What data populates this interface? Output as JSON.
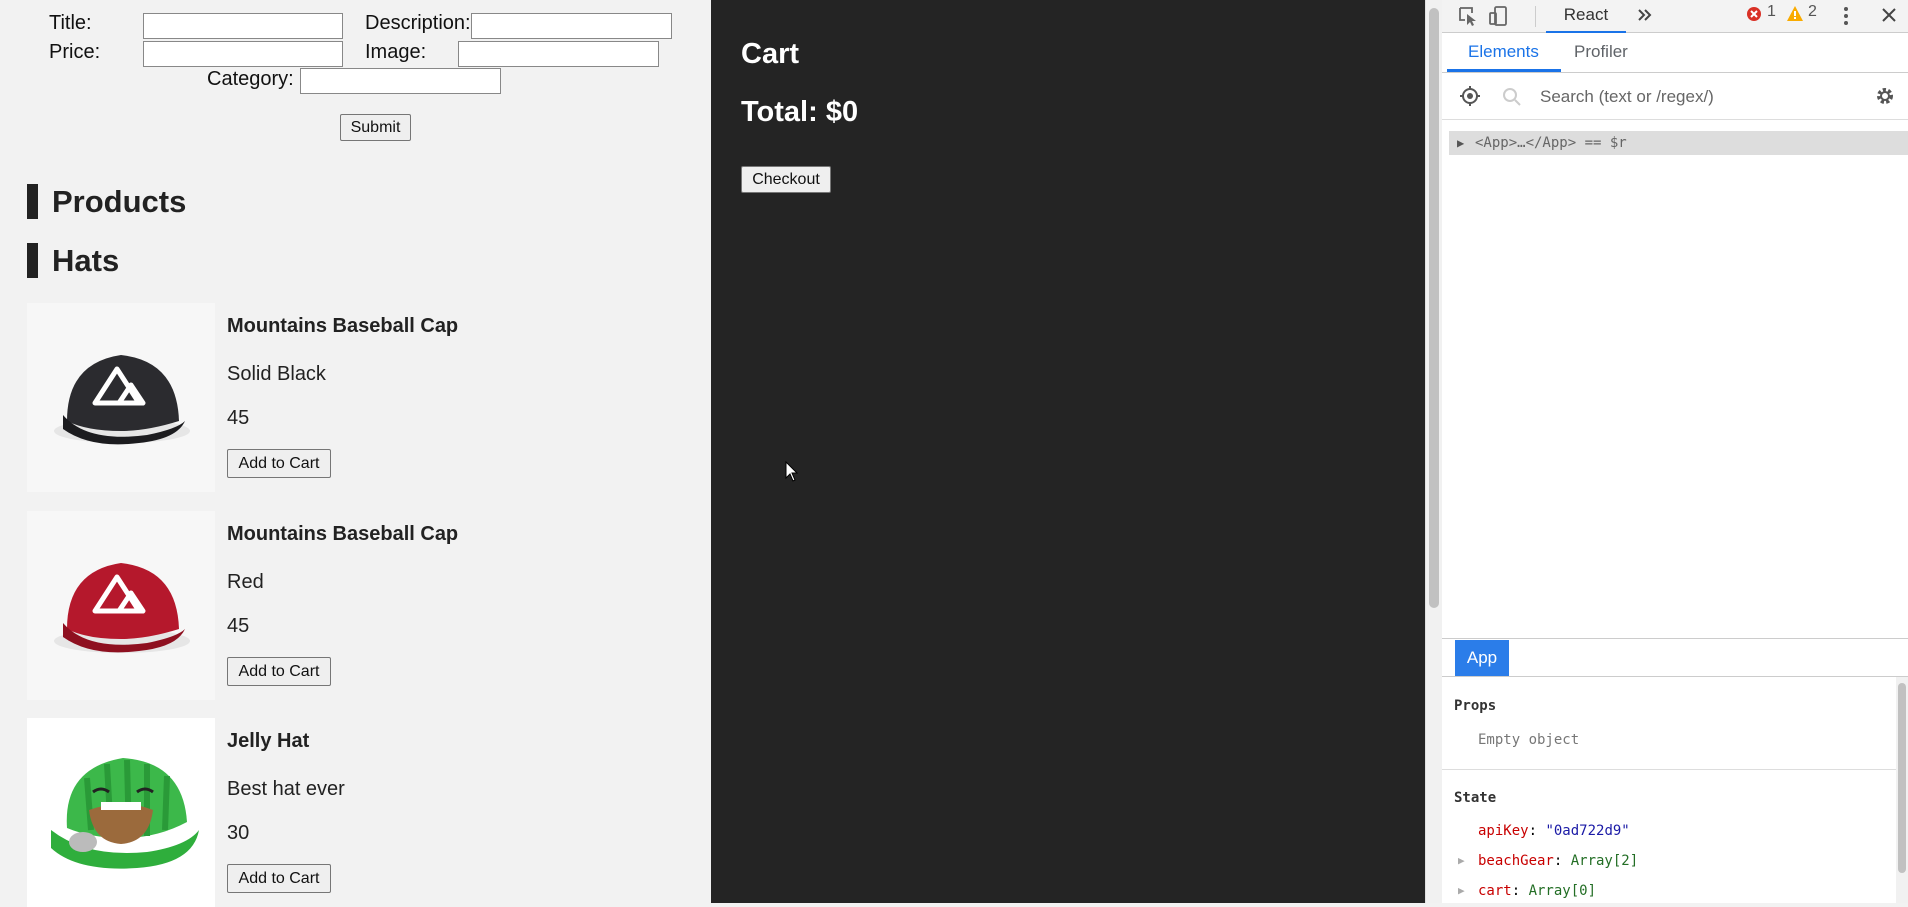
{
  "form": {
    "title_label": "Title:",
    "description_label": "Description:",
    "price_label": "Price:",
    "image_label": "Image:",
    "category_label": "Category:",
    "title_value": "",
    "description_value": "",
    "price_value": "",
    "image_value": "",
    "category_value": "",
    "submit_label": "Submit"
  },
  "headings": {
    "products": "Products",
    "hats": "Hats"
  },
  "products": [
    {
      "title": "Mountains Baseball Cap",
      "description": "Solid Black",
      "price": "45",
      "button": "Add to Cart",
      "image": "black-mountain-cap"
    },
    {
      "title": "Mountains Baseball Cap",
      "description": "Red",
      "price": "45",
      "button": "Add to Cart",
      "image": "red-mountain-cap"
    },
    {
      "title": "Jelly Hat",
      "description": "Best hat ever",
      "price": "30",
      "button": "Add to Cart",
      "image": "green-jelly-hat"
    }
  ],
  "cart": {
    "title": "Cart",
    "total": "Total: $0",
    "checkout_label": "Checkout"
  },
  "devtools": {
    "main_tab": "React",
    "error_count": "1",
    "warning_count": "2",
    "subtabs": {
      "elements": "Elements",
      "profiler": "Profiler"
    },
    "search_placeholder": "Search (text or /regex/)",
    "tree_row": "<App>…</App> == $r",
    "selected_component": "App",
    "props_heading": "Props",
    "props_empty": "Empty object",
    "state_heading": "State",
    "state": [
      {
        "key": "apiKey",
        "value": "\"0ad722d9\"",
        "kind": "string",
        "expandable": false
      },
      {
        "key": "beachGear",
        "value": "Array[2]",
        "kind": "array",
        "expandable": true
      },
      {
        "key": "cart",
        "value": "Array[0]",
        "kind": "array",
        "expandable": true
      }
    ]
  },
  "colors": {
    "accent": "#1a73e8",
    "selected_component_bg": "#2b7de9",
    "cart_bg": "#242424",
    "app_bg": "#f2f2f2",
    "error": "#d93025",
    "warning": "#f9ab00"
  }
}
